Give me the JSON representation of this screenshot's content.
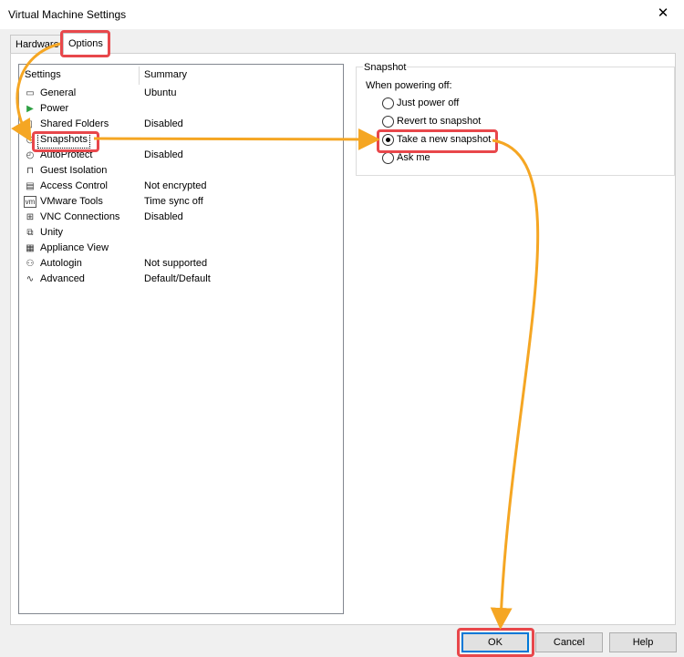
{
  "window": {
    "title": "Virtual Machine Settings",
    "close_glyph": "✕"
  },
  "tabs": [
    {
      "label": "Hardware"
    },
    {
      "label": "Options"
    }
  ],
  "list": {
    "headers": {
      "settings": "Settings",
      "summary": "Summary"
    },
    "items": [
      {
        "label": "General",
        "summary": "Ubuntu",
        "icon": "monitor-icon",
        "glyph": "▭"
      },
      {
        "label": "Power",
        "summary": "",
        "icon": "play-icon",
        "glyph": "▶"
      },
      {
        "label": "Shared Folders",
        "summary": "Disabled",
        "icon": "folder-icon",
        "glyph": "▯"
      },
      {
        "label": "Snapshots",
        "summary": "",
        "icon": "clock-icon",
        "glyph": "◷"
      },
      {
        "label": "AutoProtect",
        "summary": "Disabled",
        "icon": "clock-icon",
        "glyph": "◴"
      },
      {
        "label": "Guest Isolation",
        "summary": "",
        "icon": "lock-icon",
        "glyph": "⊓"
      },
      {
        "label": "Access Control",
        "summary": "Not encrypted",
        "icon": "document-lock-icon",
        "glyph": "▤"
      },
      {
        "label": "VMware Tools",
        "summary": "Time sync off",
        "icon": "vm-icon",
        "glyph": "vm"
      },
      {
        "label": "VNC Connections",
        "summary": "Disabled",
        "icon": "network-icon",
        "glyph": "⊞"
      },
      {
        "label": "Unity",
        "summary": "",
        "icon": "windows-icon",
        "glyph": "⧉"
      },
      {
        "label": "Appliance View",
        "summary": "",
        "icon": "appliance-icon",
        "glyph": "▦"
      },
      {
        "label": "Autologin",
        "summary": "Not supported",
        "icon": "users-icon",
        "glyph": "⚇"
      },
      {
        "label": "Advanced",
        "summary": "Default/Default",
        "icon": "waveform-icon",
        "glyph": "∿"
      }
    ]
  },
  "snapshot": {
    "group_title": "Snapshot",
    "prompt": "When powering off:",
    "options": [
      {
        "label": "Just power off",
        "selected": false
      },
      {
        "label": "Revert to snapshot",
        "selected": false
      },
      {
        "label": "Take a new snapshot",
        "selected": true
      },
      {
        "label": "Ask me",
        "selected": false
      }
    ]
  },
  "buttons": {
    "ok": "OK",
    "cancel": "Cancel",
    "help": "Help"
  },
  "colors": {
    "highlight": "#e8474b",
    "arrow": "#f5a623",
    "focus": "#0078d7"
  }
}
